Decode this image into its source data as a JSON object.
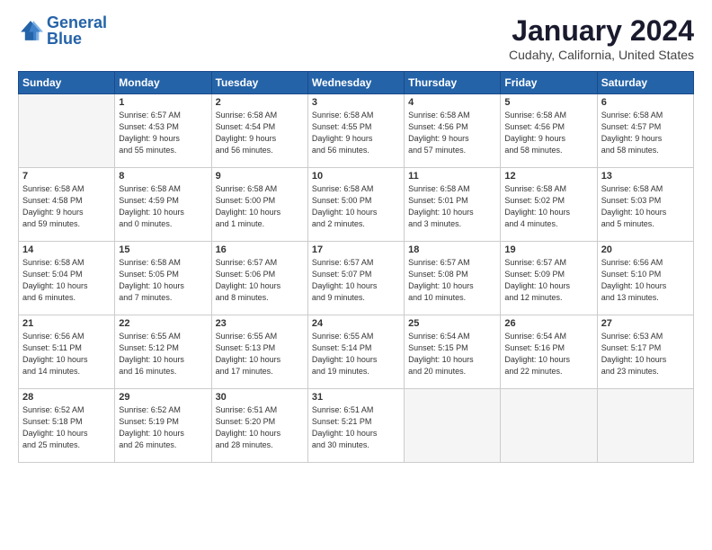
{
  "logo": {
    "text_general": "General",
    "text_blue": "Blue"
  },
  "title": "January 2024",
  "location": "Cudahy, California, United States",
  "header_days": [
    "Sunday",
    "Monday",
    "Tuesday",
    "Wednesday",
    "Thursday",
    "Friday",
    "Saturday"
  ],
  "weeks": [
    [
      {
        "num": "",
        "info": ""
      },
      {
        "num": "1",
        "info": "Sunrise: 6:57 AM\nSunset: 4:53 PM\nDaylight: 9 hours\nand 55 minutes."
      },
      {
        "num": "2",
        "info": "Sunrise: 6:58 AM\nSunset: 4:54 PM\nDaylight: 9 hours\nand 56 minutes."
      },
      {
        "num": "3",
        "info": "Sunrise: 6:58 AM\nSunset: 4:55 PM\nDaylight: 9 hours\nand 56 minutes."
      },
      {
        "num": "4",
        "info": "Sunrise: 6:58 AM\nSunset: 4:56 PM\nDaylight: 9 hours\nand 57 minutes."
      },
      {
        "num": "5",
        "info": "Sunrise: 6:58 AM\nSunset: 4:56 PM\nDaylight: 9 hours\nand 58 minutes."
      },
      {
        "num": "6",
        "info": "Sunrise: 6:58 AM\nSunset: 4:57 PM\nDaylight: 9 hours\nand 58 minutes."
      }
    ],
    [
      {
        "num": "7",
        "info": "Sunrise: 6:58 AM\nSunset: 4:58 PM\nDaylight: 9 hours\nand 59 minutes."
      },
      {
        "num": "8",
        "info": "Sunrise: 6:58 AM\nSunset: 4:59 PM\nDaylight: 10 hours\nand 0 minutes."
      },
      {
        "num": "9",
        "info": "Sunrise: 6:58 AM\nSunset: 5:00 PM\nDaylight: 10 hours\nand 1 minute."
      },
      {
        "num": "10",
        "info": "Sunrise: 6:58 AM\nSunset: 5:00 PM\nDaylight: 10 hours\nand 2 minutes."
      },
      {
        "num": "11",
        "info": "Sunrise: 6:58 AM\nSunset: 5:01 PM\nDaylight: 10 hours\nand 3 minutes."
      },
      {
        "num": "12",
        "info": "Sunrise: 6:58 AM\nSunset: 5:02 PM\nDaylight: 10 hours\nand 4 minutes."
      },
      {
        "num": "13",
        "info": "Sunrise: 6:58 AM\nSunset: 5:03 PM\nDaylight: 10 hours\nand 5 minutes."
      }
    ],
    [
      {
        "num": "14",
        "info": "Sunrise: 6:58 AM\nSunset: 5:04 PM\nDaylight: 10 hours\nand 6 minutes."
      },
      {
        "num": "15",
        "info": "Sunrise: 6:58 AM\nSunset: 5:05 PM\nDaylight: 10 hours\nand 7 minutes."
      },
      {
        "num": "16",
        "info": "Sunrise: 6:57 AM\nSunset: 5:06 PM\nDaylight: 10 hours\nand 8 minutes."
      },
      {
        "num": "17",
        "info": "Sunrise: 6:57 AM\nSunset: 5:07 PM\nDaylight: 10 hours\nand 9 minutes."
      },
      {
        "num": "18",
        "info": "Sunrise: 6:57 AM\nSunset: 5:08 PM\nDaylight: 10 hours\nand 10 minutes."
      },
      {
        "num": "19",
        "info": "Sunrise: 6:57 AM\nSunset: 5:09 PM\nDaylight: 10 hours\nand 12 minutes."
      },
      {
        "num": "20",
        "info": "Sunrise: 6:56 AM\nSunset: 5:10 PM\nDaylight: 10 hours\nand 13 minutes."
      }
    ],
    [
      {
        "num": "21",
        "info": "Sunrise: 6:56 AM\nSunset: 5:11 PM\nDaylight: 10 hours\nand 14 minutes."
      },
      {
        "num": "22",
        "info": "Sunrise: 6:55 AM\nSunset: 5:12 PM\nDaylight: 10 hours\nand 16 minutes."
      },
      {
        "num": "23",
        "info": "Sunrise: 6:55 AM\nSunset: 5:13 PM\nDaylight: 10 hours\nand 17 minutes."
      },
      {
        "num": "24",
        "info": "Sunrise: 6:55 AM\nSunset: 5:14 PM\nDaylight: 10 hours\nand 19 minutes."
      },
      {
        "num": "25",
        "info": "Sunrise: 6:54 AM\nSunset: 5:15 PM\nDaylight: 10 hours\nand 20 minutes."
      },
      {
        "num": "26",
        "info": "Sunrise: 6:54 AM\nSunset: 5:16 PM\nDaylight: 10 hours\nand 22 minutes."
      },
      {
        "num": "27",
        "info": "Sunrise: 6:53 AM\nSunset: 5:17 PM\nDaylight: 10 hours\nand 23 minutes."
      }
    ],
    [
      {
        "num": "28",
        "info": "Sunrise: 6:52 AM\nSunset: 5:18 PM\nDaylight: 10 hours\nand 25 minutes."
      },
      {
        "num": "29",
        "info": "Sunrise: 6:52 AM\nSunset: 5:19 PM\nDaylight: 10 hours\nand 26 minutes."
      },
      {
        "num": "30",
        "info": "Sunrise: 6:51 AM\nSunset: 5:20 PM\nDaylight: 10 hours\nand 28 minutes."
      },
      {
        "num": "31",
        "info": "Sunrise: 6:51 AM\nSunset: 5:21 PM\nDaylight: 10 hours\nand 30 minutes."
      },
      {
        "num": "",
        "info": ""
      },
      {
        "num": "",
        "info": ""
      },
      {
        "num": "",
        "info": ""
      }
    ]
  ]
}
